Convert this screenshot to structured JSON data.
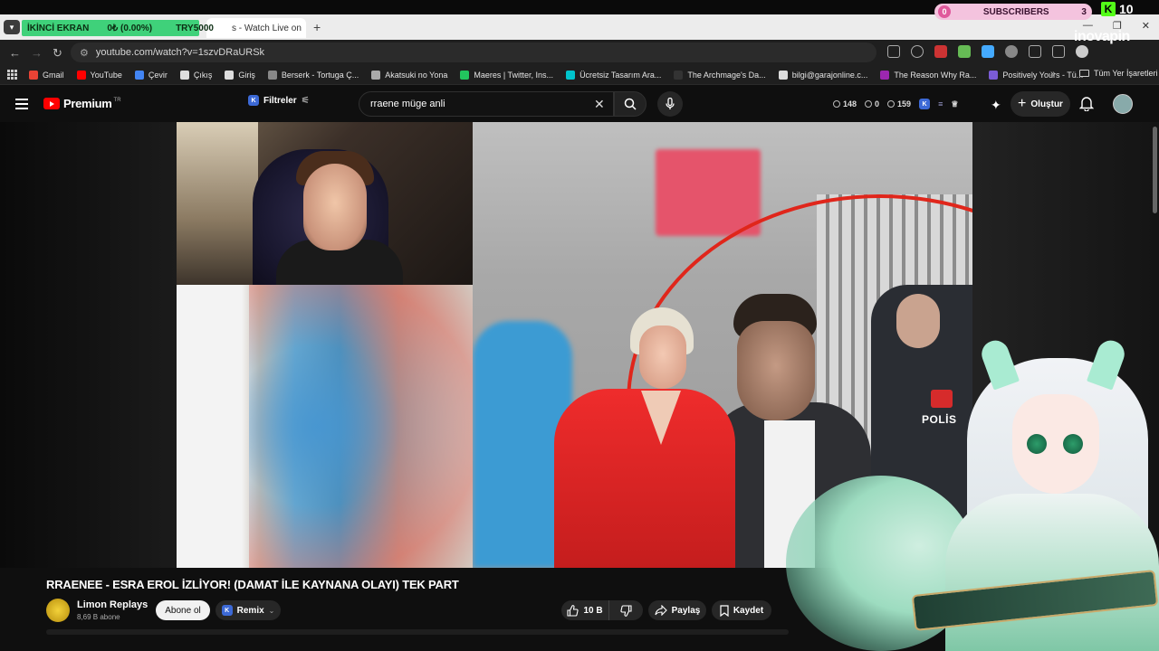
{
  "overlay": {
    "screen_label": "İKİNCİ EKRAN",
    "progress_text": "0₺ (0.00%)",
    "goal_text": "TRY5000",
    "subscribers_label": "SUBSCRIBERS",
    "subscribers_left": "0",
    "subscribers_right": "3",
    "kick_letter": "K",
    "kick_count": "10",
    "sponsor": "inovapin"
  },
  "browser": {
    "tab_title": "s - Watch Live on",
    "new_tab": "+",
    "url": "youtube.com/watch?v=1szvDRaURSk",
    "window_controls": [
      "—",
      "❐",
      "✕"
    ]
  },
  "bookmarks": {
    "items": [
      {
        "label": "Gmail",
        "color": "#ea4335"
      },
      {
        "label": "YouTube",
        "color": "#ff0000"
      },
      {
        "label": "Çevir",
        "color": "#4285f4"
      },
      {
        "label": "Çıkış",
        "color": "#dddddd"
      },
      {
        "label": "Giriş",
        "color": "#dddddd"
      },
      {
        "label": "Berserk - Tortuga Ç...",
        "color": "#888888"
      },
      {
        "label": "Akatsuki no Yona",
        "color": "#aaaaaa"
      },
      {
        "label": "Maeres | Twitter, Ins...",
        "color": "#22c55e"
      },
      {
        "label": "Ücretsiz Tasarım Ara...",
        "color": "#00c4cc"
      },
      {
        "label": "The Archmage's Da...",
        "color": "#333333"
      },
      {
        "label": "bilgi@garajonline.c...",
        "color": "#dddddd"
      },
      {
        "label": "The Reason Why Ra...",
        "color": "#9c27b0"
      },
      {
        "label": "Positively Yours - Tü...",
        "color": "#7b5cd6"
      }
    ],
    "more": "»",
    "all_bookmarks": "Tüm Yer İşaretleri"
  },
  "youtube": {
    "logo_text": "Premium",
    "region": "TR",
    "filters_label": "Filtreler",
    "search_query": "rraene müge anli",
    "stats": [
      "148",
      "0",
      "159"
    ],
    "create_label": "Oluştur"
  },
  "video": {
    "title": "RRAENEE - ESRA EROL İZLİYOR! (DAMAT İLE KAYNANA OLAYI) TEK PART",
    "police_text": "POLİS",
    "channel_name": "Limon Replays",
    "channel_subs": "8,69 B abone",
    "subscribe_label": "Abone ol",
    "remix_label": "Remix",
    "like_count": "10 B",
    "share_label": "Paylaş",
    "save_label": "Kaydet"
  },
  "colors": {
    "youtube_red": "#ff0000",
    "overlay_green": "#3fd17a",
    "kick_green": "#53fc18",
    "subs_pink": "#f4c3de"
  }
}
